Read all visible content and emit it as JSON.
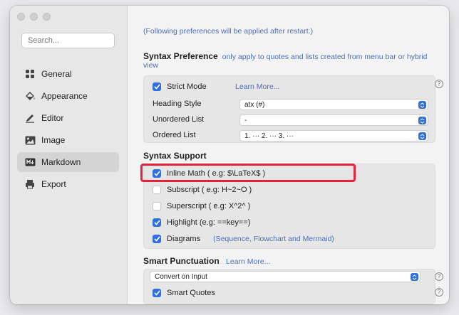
{
  "sidebar": {
    "search_placeholder": "Search...",
    "items": [
      {
        "label": "General",
        "icon": "general-icon"
      },
      {
        "label": "Appearance",
        "icon": "appearance-icon"
      },
      {
        "label": "Editor",
        "icon": "editor-icon"
      },
      {
        "label": "Image",
        "icon": "image-icon"
      },
      {
        "label": "Markdown",
        "icon": "markdown-icon",
        "active": true
      },
      {
        "label": "Export",
        "icon": "export-icon"
      }
    ]
  },
  "main": {
    "note": "(Following preferences will be applied after restart.)",
    "syntax_preference": {
      "title": "Syntax Preference",
      "subtitle": "only apply to quotes and lists created from menu bar or hybrid",
      "subtitle_cont": "view",
      "strict_mode_label": "Strict Mode",
      "strict_mode_checked": true,
      "learn_more": "Learn More...",
      "heading_style_label": "Heading Style",
      "heading_style_value": "atx (#)",
      "unordered_list_label": "Unordered List",
      "unordered_list_value": "-",
      "ordered_list_label": "Ordered List",
      "ordered_list_value": "1. ··· 2. ··· 3. ···"
    },
    "syntax_support": {
      "title": "Syntax Support",
      "inline_math": "Inline Math ( e.g: $\\LaTeX$ )",
      "subscript": "Subscript ( e.g: H~2~O )",
      "superscript": "Superscript ( e.g: X^2^ )",
      "highlight": "Highlight (e.g: ==key==)",
      "diagrams": "Diagrams",
      "diagrams_note": "(Sequence, Flowchart and Mermaid)"
    },
    "smart_punctuation": {
      "title": "Smart Punctuation",
      "learn_more": "Learn More...",
      "mode_value": "Convert on Input",
      "smart_quotes": "Smart Quotes"
    },
    "help_symbol": "?"
  },
  "colors": {
    "accent": "#2f6fe0",
    "highlight_box": "#e8223c",
    "link": "#4e6fb5"
  }
}
